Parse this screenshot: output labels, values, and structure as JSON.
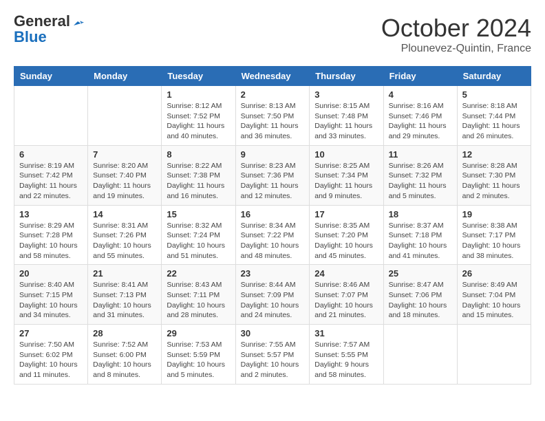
{
  "header": {
    "logo_general": "General",
    "logo_blue": "Blue",
    "month_title": "October 2024",
    "location": "Plounevez-Quintin, France"
  },
  "weekdays": [
    "Sunday",
    "Monday",
    "Tuesday",
    "Wednesday",
    "Thursday",
    "Friday",
    "Saturday"
  ],
  "weeks": [
    [
      {
        "day": "",
        "info": ""
      },
      {
        "day": "",
        "info": ""
      },
      {
        "day": "1",
        "info": "Sunrise: 8:12 AM\nSunset: 7:52 PM\nDaylight: 11 hours and 40 minutes."
      },
      {
        "day": "2",
        "info": "Sunrise: 8:13 AM\nSunset: 7:50 PM\nDaylight: 11 hours and 36 minutes."
      },
      {
        "day": "3",
        "info": "Sunrise: 8:15 AM\nSunset: 7:48 PM\nDaylight: 11 hours and 33 minutes."
      },
      {
        "day": "4",
        "info": "Sunrise: 8:16 AM\nSunset: 7:46 PM\nDaylight: 11 hours and 29 minutes."
      },
      {
        "day": "5",
        "info": "Sunrise: 8:18 AM\nSunset: 7:44 PM\nDaylight: 11 hours and 26 minutes."
      }
    ],
    [
      {
        "day": "6",
        "info": "Sunrise: 8:19 AM\nSunset: 7:42 PM\nDaylight: 11 hours and 22 minutes."
      },
      {
        "day": "7",
        "info": "Sunrise: 8:20 AM\nSunset: 7:40 PM\nDaylight: 11 hours and 19 minutes."
      },
      {
        "day": "8",
        "info": "Sunrise: 8:22 AM\nSunset: 7:38 PM\nDaylight: 11 hours and 16 minutes."
      },
      {
        "day": "9",
        "info": "Sunrise: 8:23 AM\nSunset: 7:36 PM\nDaylight: 11 hours and 12 minutes."
      },
      {
        "day": "10",
        "info": "Sunrise: 8:25 AM\nSunset: 7:34 PM\nDaylight: 11 hours and 9 minutes."
      },
      {
        "day": "11",
        "info": "Sunrise: 8:26 AM\nSunset: 7:32 PM\nDaylight: 11 hours and 5 minutes."
      },
      {
        "day": "12",
        "info": "Sunrise: 8:28 AM\nSunset: 7:30 PM\nDaylight: 11 hours and 2 minutes."
      }
    ],
    [
      {
        "day": "13",
        "info": "Sunrise: 8:29 AM\nSunset: 7:28 PM\nDaylight: 10 hours and 58 minutes."
      },
      {
        "day": "14",
        "info": "Sunrise: 8:31 AM\nSunset: 7:26 PM\nDaylight: 10 hours and 55 minutes."
      },
      {
        "day": "15",
        "info": "Sunrise: 8:32 AM\nSunset: 7:24 PM\nDaylight: 10 hours and 51 minutes."
      },
      {
        "day": "16",
        "info": "Sunrise: 8:34 AM\nSunset: 7:22 PM\nDaylight: 10 hours and 48 minutes."
      },
      {
        "day": "17",
        "info": "Sunrise: 8:35 AM\nSunset: 7:20 PM\nDaylight: 10 hours and 45 minutes."
      },
      {
        "day": "18",
        "info": "Sunrise: 8:37 AM\nSunset: 7:18 PM\nDaylight: 10 hours and 41 minutes."
      },
      {
        "day": "19",
        "info": "Sunrise: 8:38 AM\nSunset: 7:17 PM\nDaylight: 10 hours and 38 minutes."
      }
    ],
    [
      {
        "day": "20",
        "info": "Sunrise: 8:40 AM\nSunset: 7:15 PM\nDaylight: 10 hours and 34 minutes."
      },
      {
        "day": "21",
        "info": "Sunrise: 8:41 AM\nSunset: 7:13 PM\nDaylight: 10 hours and 31 minutes."
      },
      {
        "day": "22",
        "info": "Sunrise: 8:43 AM\nSunset: 7:11 PM\nDaylight: 10 hours and 28 minutes."
      },
      {
        "day": "23",
        "info": "Sunrise: 8:44 AM\nSunset: 7:09 PM\nDaylight: 10 hours and 24 minutes."
      },
      {
        "day": "24",
        "info": "Sunrise: 8:46 AM\nSunset: 7:07 PM\nDaylight: 10 hours and 21 minutes."
      },
      {
        "day": "25",
        "info": "Sunrise: 8:47 AM\nSunset: 7:06 PM\nDaylight: 10 hours and 18 minutes."
      },
      {
        "day": "26",
        "info": "Sunrise: 8:49 AM\nSunset: 7:04 PM\nDaylight: 10 hours and 15 minutes."
      }
    ],
    [
      {
        "day": "27",
        "info": "Sunrise: 7:50 AM\nSunset: 6:02 PM\nDaylight: 10 hours and 11 minutes."
      },
      {
        "day": "28",
        "info": "Sunrise: 7:52 AM\nSunset: 6:00 PM\nDaylight: 10 hours and 8 minutes."
      },
      {
        "day": "29",
        "info": "Sunrise: 7:53 AM\nSunset: 5:59 PM\nDaylight: 10 hours and 5 minutes."
      },
      {
        "day": "30",
        "info": "Sunrise: 7:55 AM\nSunset: 5:57 PM\nDaylight: 10 hours and 2 minutes."
      },
      {
        "day": "31",
        "info": "Sunrise: 7:57 AM\nSunset: 5:55 PM\nDaylight: 9 hours and 58 minutes."
      },
      {
        "day": "",
        "info": ""
      },
      {
        "day": "",
        "info": ""
      }
    ]
  ]
}
